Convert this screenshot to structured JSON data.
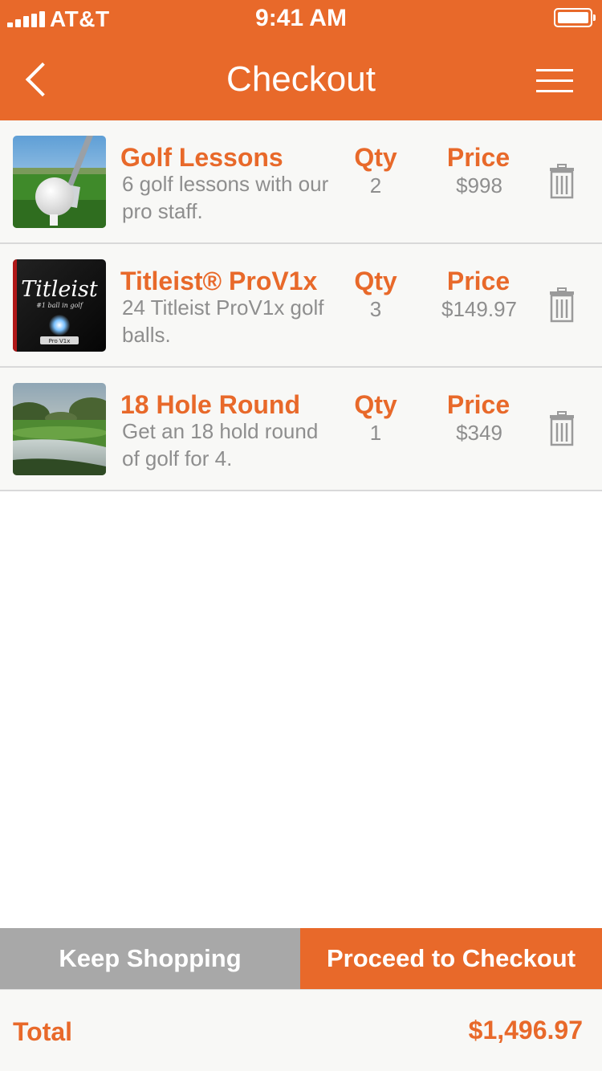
{
  "status_bar": {
    "carrier": "AT&T",
    "time": "9:41 AM"
  },
  "nav": {
    "title": "Checkout",
    "back_icon": "chevron-left-icon",
    "menu_icon": "hamburger-menu-icon"
  },
  "cart": {
    "qty_label": "Qty",
    "price_label": "Price",
    "items": [
      {
        "name": "Golf Lessons",
        "description": "6 golf lessons with our pro staff.",
        "qty": "2",
        "price": "$998",
        "image": "golf-ball-on-tee"
      },
      {
        "name": "Titleist® ProV1x",
        "description": "24 Titleist ProV1x golf balls.",
        "qty": "3",
        "price": "$149.97",
        "image": "titleist-box",
        "image_text": "Titleist",
        "image_subtext": "#1 ball in golf",
        "image_badge": "Pro V1x"
      },
      {
        "name": "18 Hole Round",
        "description": "Get an 18 hold round of golf for 4.",
        "qty": "1",
        "price": "$349",
        "image": "golf-course"
      }
    ]
  },
  "actions": {
    "keep_shopping": "Keep Shopping",
    "proceed": "Proceed to Checkout"
  },
  "total": {
    "label": "Total",
    "value": "$1,496.97"
  },
  "colors": {
    "accent": "#e8692a",
    "secondary_button": "#a8a8a8",
    "muted_text": "#8e8e8e",
    "row_background": "#f8f8f6"
  }
}
